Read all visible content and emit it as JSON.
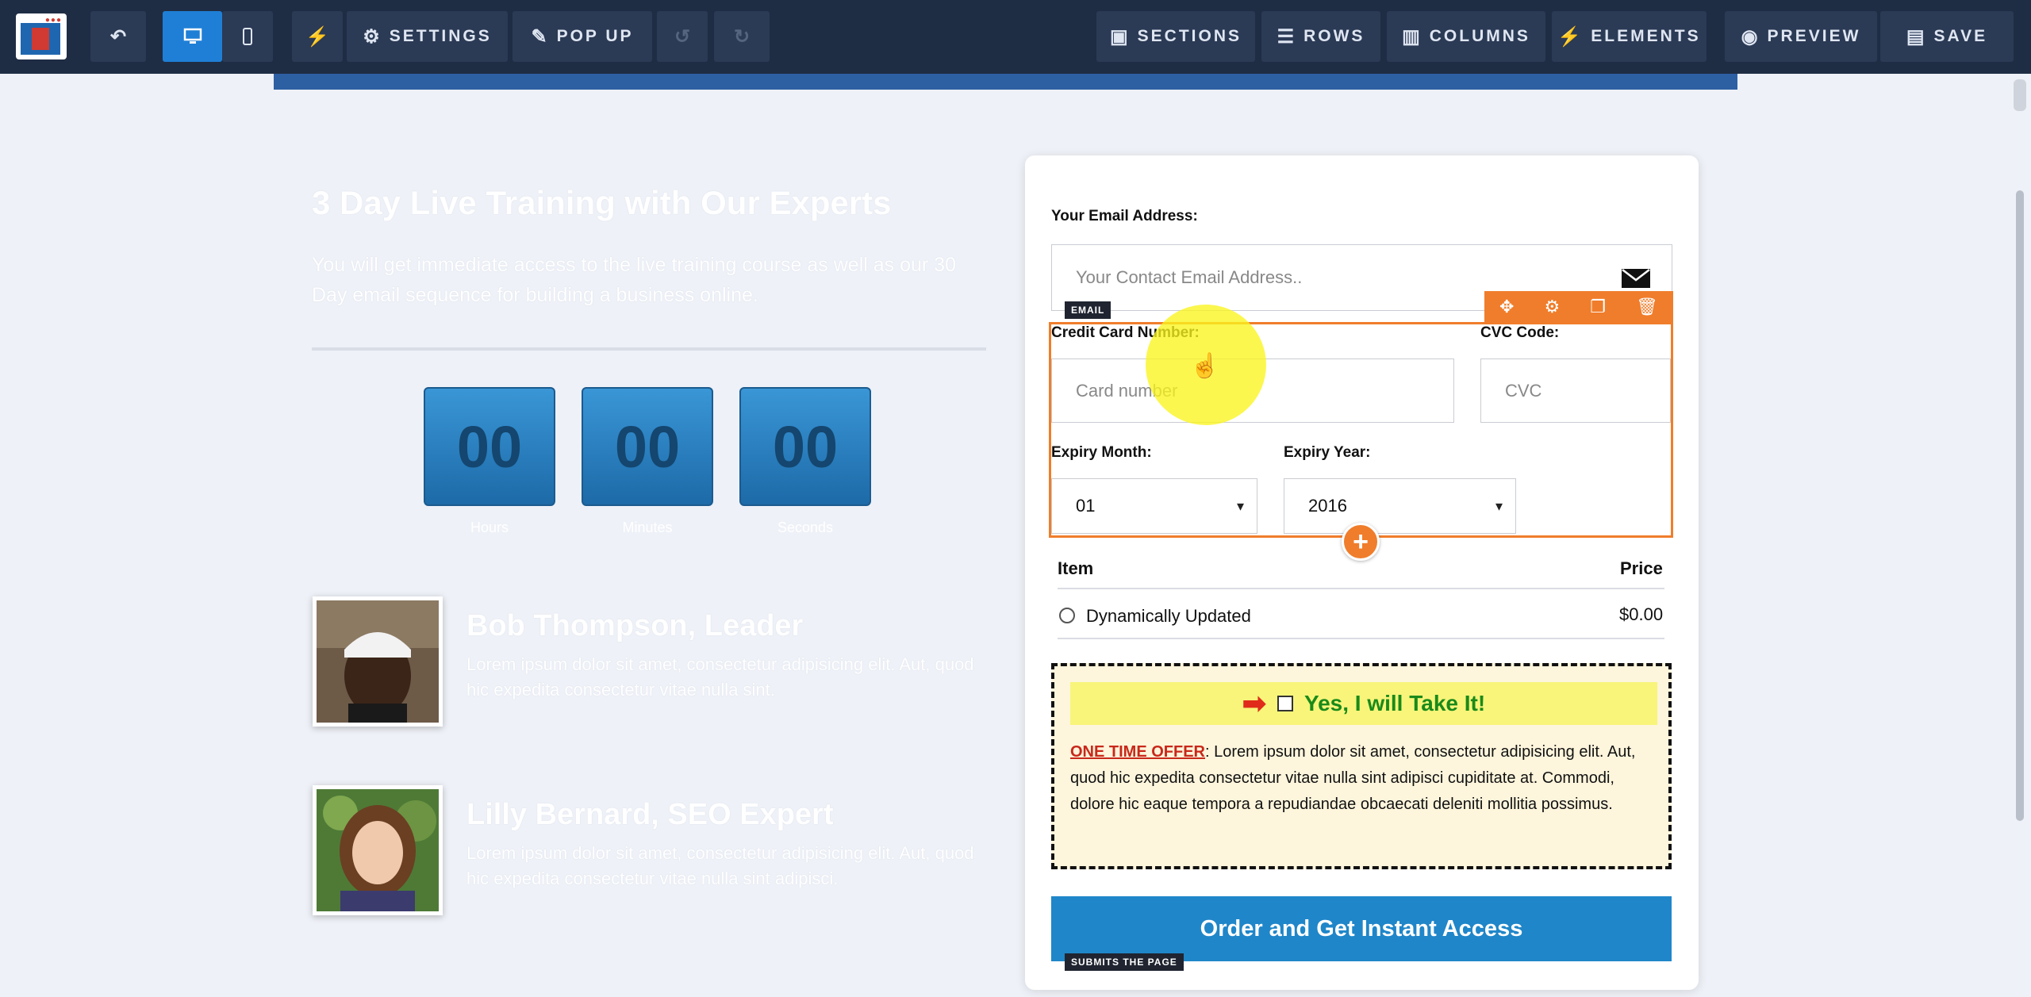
{
  "toolbar": {
    "settings_label": "SETTINGS",
    "popup_label": "POP UP",
    "sections_label": "SECTIONS",
    "rows_label": "ROWS",
    "columns_label": "COLUMNS",
    "elements_label": "ELEMENTS",
    "preview_label": "PREVIEW",
    "save_label": "SAVE"
  },
  "hero": {
    "headline": "3 Day Live Training with Our Experts",
    "subtext": "You will get immediate access to the live training course as well as our 30 Day email sequence for building a business online."
  },
  "timer": {
    "boxes": [
      {
        "value": "00",
        "label": "Hours"
      },
      {
        "value": "00",
        "label": "Minutes"
      },
      {
        "value": "00",
        "label": "Seconds"
      }
    ]
  },
  "people": [
    {
      "name": "Bob Thompson, Leader",
      "bio": "Lorem ipsum dolor sit amet, consectetur adipisicing elit. Aut, quod hic expedita consectetur vitae nulla sint."
    },
    {
      "name": "Lilly Bernard, SEO Expert",
      "bio": "Lorem ipsum dolor sit amet, consectetur adipisicing elit. Aut, quod hic expedita consectetur vitae nulla sint adipisci."
    }
  ],
  "form": {
    "email_label": "Your Email Address:",
    "email_placeholder": "Your Contact Email Address..",
    "email_tag": "EMAIL",
    "cc_label": "Credit Card Number:",
    "cc_placeholder": "Card number",
    "cvc_label": "CVC Code:",
    "cvc_placeholder": "CVC",
    "month_label": "Expiry Month:",
    "month_value": "01",
    "year_label": "Expiry Year:",
    "year_value": "2016"
  },
  "table": {
    "col_item": "Item",
    "col_price": "Price",
    "rows": [
      {
        "item": "Dynamically Updated",
        "price": "$0.00"
      }
    ]
  },
  "offer": {
    "headline": "Yes, I will Take It!",
    "label": "ONE TIME OFFER",
    "body": ": Lorem ipsum dolor sit amet, consectetur adipisicing elit. Aut, quod hic expedita consectetur vitae nulla sint adipisci cupiditate at. Commodi, dolore hic eaque tempora a repudiandae obcaecati deleniti mollitia possimus."
  },
  "submit": {
    "label": "Order and Get Instant Access",
    "tag": "SUBMITS THE PAGE"
  },
  "colors": {
    "toolbar": "#1f2d44",
    "active": "#1f7fd6",
    "selection": "#f07d2b",
    "submit": "#1f86c9"
  }
}
